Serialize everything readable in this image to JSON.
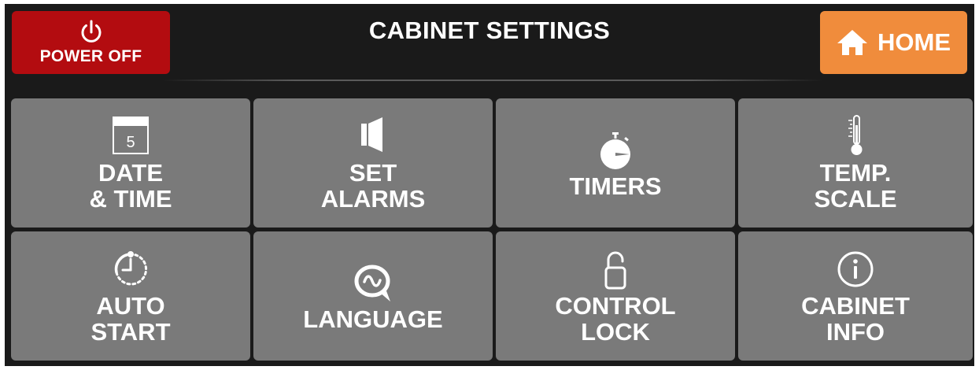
{
  "header": {
    "title": "CABINET SETTINGS",
    "power_label": "POWER OFF",
    "home_label": "HOME"
  },
  "colors": {
    "background": "#1a1a1a",
    "power_button": "#b30c10",
    "home_button": "#f08c3c",
    "tile": "#7a7a7a",
    "text": "#ffffff"
  },
  "tiles": [
    {
      "label": "DATE\n& TIME",
      "icon": "calendar-icon",
      "icon_text": "5"
    },
    {
      "label": "SET\nALARMS",
      "icon": "speaker-icon"
    },
    {
      "label": "TIMERS",
      "icon": "stopwatch-icon"
    },
    {
      "label": "TEMP.\nSCALE",
      "icon": "thermometer-icon"
    },
    {
      "label": "AUTO\nSTART",
      "icon": "auto-start-clock-icon"
    },
    {
      "label": "LANGUAGE",
      "icon": "language-bubble-icon"
    },
    {
      "label": "CONTROL\nLOCK",
      "icon": "padlock-icon"
    },
    {
      "label": "CABINET\nINFO",
      "icon": "info-icon"
    }
  ]
}
